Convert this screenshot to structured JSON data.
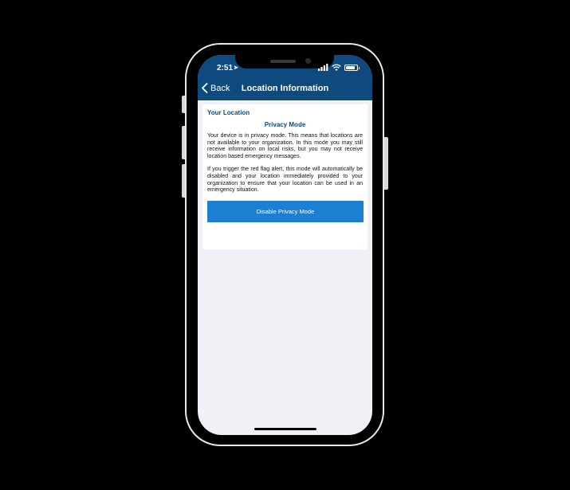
{
  "status_bar": {
    "time": "2:51",
    "location_icon": "location-arrow-icon",
    "icons": [
      "signal-icon",
      "wifi-icon",
      "battery-icon"
    ]
  },
  "nav": {
    "back_label": "Back",
    "back_icon": "chevron-left-icon",
    "title": "Location Information"
  },
  "card": {
    "section_title": "Your Location",
    "mode_title": "Privacy Mode",
    "paragraph_1": "Your device is in privacy mode. This means that locations are not available to your organization. In this mode you may still receive information on local risks, but you may not receive location based emergency messages.",
    "paragraph_2": "If you trigger the red flag alert, this mode will automatically be disabled and your location immediately provided to your organization to ensure that your location can be used in an emergency situation.",
    "button_label": "Disable Privacy Mode"
  },
  "colors": {
    "header": "#0e4a7e",
    "accent_text": "#0e4a7e",
    "button": "#1d7fd1",
    "screen_background": "#eff1f6"
  }
}
